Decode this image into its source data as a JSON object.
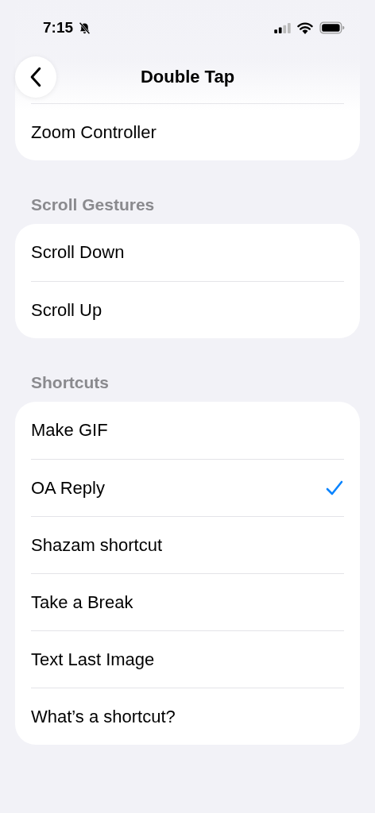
{
  "status_bar": {
    "time": "7:15",
    "silent": true
  },
  "navigation": {
    "title": "Double Tap"
  },
  "sections": [
    {
      "rows": [
        {
          "label": "Zoom Controller",
          "kind": "option",
          "selected": false
        }
      ]
    },
    {
      "header": "Scroll Gestures",
      "rows": [
        {
          "label": "Scroll Down",
          "kind": "option",
          "selected": false
        },
        {
          "label": "Scroll Up",
          "kind": "option",
          "selected": false
        }
      ]
    },
    {
      "header": "Shortcuts",
      "rows": [
        {
          "label": "Make GIF",
          "kind": "option",
          "selected": false
        },
        {
          "label": "OA Reply",
          "kind": "option",
          "selected": true
        },
        {
          "label": "Shazam shortcut",
          "kind": "option",
          "selected": false
        },
        {
          "label": "Take a Break",
          "kind": "option",
          "selected": false
        },
        {
          "label": "Text Last Image",
          "kind": "option",
          "selected": false
        },
        {
          "label": "What’s a shortcut?",
          "kind": "option",
          "selected": false
        }
      ]
    }
  ]
}
